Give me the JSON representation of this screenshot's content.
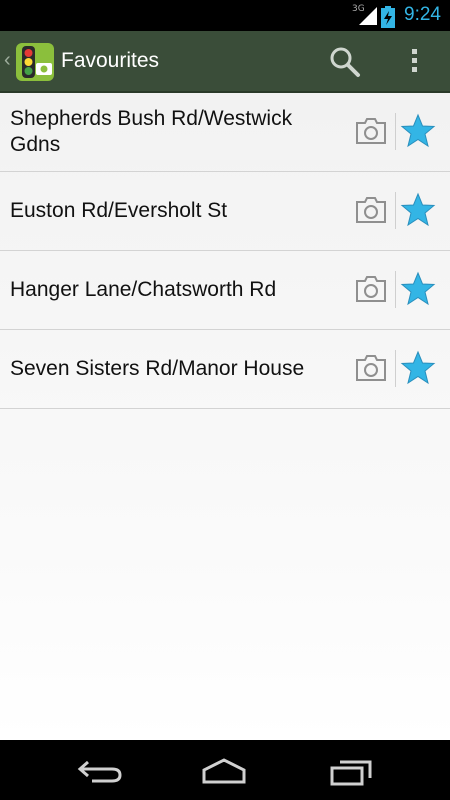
{
  "status_bar": {
    "network": "3G",
    "time": "9:24"
  },
  "action_bar": {
    "title": "Favourites"
  },
  "favourites": [
    {
      "name": "Shepherds Bush Rd/Westwick Gdns"
    },
    {
      "name": "Euston Rd/Eversholt St"
    },
    {
      "name": "Hanger Lane/Chatsworth Rd"
    },
    {
      "name": "Seven Sisters Rd/Manor House"
    }
  ],
  "colors": {
    "action_bar": "#3a4d39",
    "accent": "#33b5e5",
    "star": "#33b5e5"
  },
  "icons": {
    "back": "back-icon",
    "home": "home-icon",
    "recents": "recents-icon",
    "search": "search-icon",
    "overflow": "overflow-menu-icon",
    "camera": "camera-icon",
    "star": "star-icon"
  }
}
